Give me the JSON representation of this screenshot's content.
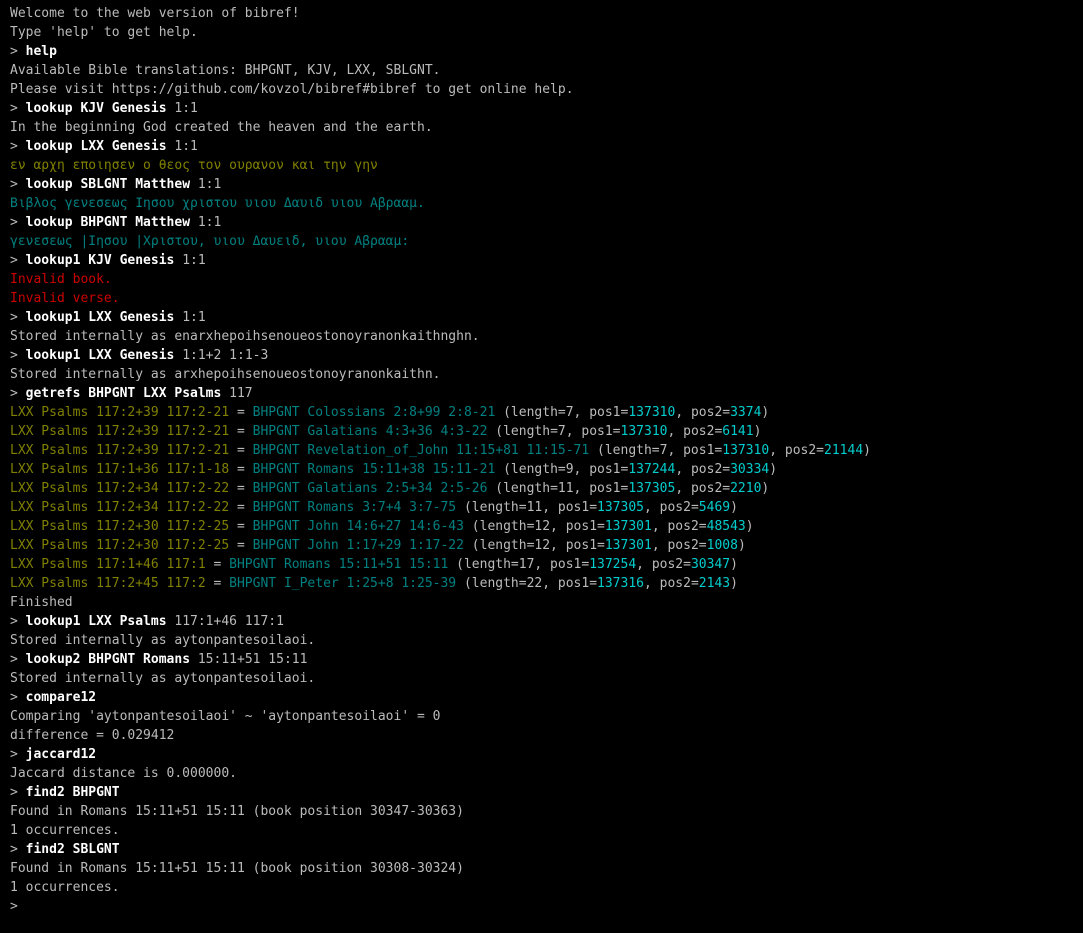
{
  "intro": [
    "Welcome to the web version of bibref!",
    "Type 'help' to get help."
  ],
  "blocks": [
    {
      "cmd_bold": "help",
      "cmd_rest": "",
      "out": [
        "Available Bible translations: BHPGNT, KJV, LXX, SBLGNT.",
        "Please visit https://github.com/kovzol/bibref#bibref to get online help."
      ]
    },
    {
      "cmd_bold": "lookup KJV Genesis",
      "cmd_rest": " 1:1",
      "out": [
        "In the beginning God created the heaven and the earth."
      ]
    },
    {
      "cmd_bold": "lookup LXX Genesis",
      "cmd_rest": " 1:1",
      "out_olive": [
        "εν αρχη εποιησεν ο θεος τον ουρανον και την γην"
      ]
    },
    {
      "cmd_bold": "lookup SBLGNT Matthew",
      "cmd_rest": " 1:1",
      "out_teal": [
        "Βιβλος γενεσεως Ιησου χριστου υιου Δαυιδ υιου Αβρααμ."
      ]
    },
    {
      "cmd_bold": "lookup BHPGNT Matthew",
      "cmd_rest": " 1:1",
      "out_teal": [
        "γενεσεως |Ιησου |Χριστου, υιου Δαυειδ, υιου Αβρααμ:"
      ]
    },
    {
      "cmd_bold": "lookup1 KJV Genesis",
      "cmd_rest": " 1:1",
      "out_red": [
        "Invalid book.",
        "Invalid verse."
      ]
    },
    {
      "cmd_bold": "lookup1 LXX Genesis",
      "cmd_rest": " 1:1",
      "out": [
        "Stored internally as enarxhepoihsenoueostonoyranonkaithnghn."
      ]
    },
    {
      "cmd_bold": "lookup1 LXX Genesis",
      "cmd_rest": " 1:1+2 1:1-3",
      "out": [
        "Stored internally as arxhepoihsenoueostonoyranonkaithn."
      ]
    },
    {
      "cmd_bold": "getrefs BHPGNT LXX Psalms",
      "cmd_rest": " 117",
      "refs": [
        {
          "lxx": "LXX Psalms 117:2+39 117:2-21",
          "eq": " = ",
          "bhp": "BHPGNT Colossians 2:8+99 2:8-21",
          "meta": " (length=7, pos1=",
          "p1": "137310",
          "sep": ", pos2=",
          "p2": "3374",
          "tail": ")"
        },
        {
          "lxx": "LXX Psalms 117:2+39 117:2-21",
          "eq": " = ",
          "bhp": "BHPGNT Galatians 4:3+36 4:3-22",
          "meta": " (length=7, pos1=",
          "p1": "137310",
          "sep": ", pos2=",
          "p2": "6141",
          "tail": ")"
        },
        {
          "lxx": "LXX Psalms 117:2+39 117:2-21",
          "eq": " = ",
          "bhp": "BHPGNT Revelation_of_John 11:15+81 11:15-71",
          "meta": " (length=7, pos1=",
          "p1": "137310",
          "sep": ", pos2=",
          "p2": "21144",
          "tail": ")"
        },
        {
          "lxx": "LXX Psalms 117:1+36 117:1-18",
          "eq": " = ",
          "bhp": "BHPGNT Romans 15:11+38 15:11-21",
          "meta": " (length=9, pos1=",
          "p1": "137244",
          "sep": ", pos2=",
          "p2": "30334",
          "tail": ")"
        },
        {
          "lxx": "LXX Psalms 117:2+34 117:2-22",
          "eq": " = ",
          "bhp": "BHPGNT Galatians 2:5+34 2:5-26",
          "meta": " (length=11, pos1=",
          "p1": "137305",
          "sep": ", pos2=",
          "p2": "2210",
          "tail": ")"
        },
        {
          "lxx": "LXX Psalms 117:2+34 117:2-22",
          "eq": " = ",
          "bhp": "BHPGNT Romans 3:7+4 3:7-75",
          "meta": " (length=11, pos1=",
          "p1": "137305",
          "sep": ", pos2=",
          "p2": "5469",
          "tail": ")"
        },
        {
          "lxx": "LXX Psalms 117:2+30 117:2-25",
          "eq": " = ",
          "bhp": "BHPGNT John 14:6+27 14:6-43",
          "meta": " (length=12, pos1=",
          "p1": "137301",
          "sep": ", pos2=",
          "p2": "48543",
          "tail": ")"
        },
        {
          "lxx": "LXX Psalms 117:2+30 117:2-25",
          "eq": " = ",
          "bhp": "BHPGNT John 1:17+29 1:17-22",
          "meta": " (length=12, pos1=",
          "p1": "137301",
          "sep": ", pos2=",
          "p2": "1008",
          "tail": ")"
        },
        {
          "lxx": "LXX Psalms 117:1+46 117:1",
          "eq": " = ",
          "bhp": "BHPGNT Romans 15:11+51 15:11",
          "meta": " (length=17, pos1=",
          "p1": "137254",
          "sep": ", pos2=",
          "p2": "30347",
          "tail": ")"
        },
        {
          "lxx": "LXX Psalms 117:2+45 117:2",
          "eq": " = ",
          "bhp": "BHPGNT I_Peter 1:25+8 1:25-39",
          "meta": " (length=22, pos1=",
          "p1": "137316",
          "sep": ", pos2=",
          "p2": "2143",
          "tail": ")"
        }
      ],
      "out_after": [
        "Finished"
      ]
    },
    {
      "cmd_bold": "lookup1 LXX Psalms",
      "cmd_rest": " 117:1+46 117:1",
      "out": [
        "Stored internally as aytonpantesoilaoi."
      ]
    },
    {
      "cmd_bold": "lookup2 BHPGNT Romans",
      "cmd_rest": " 15:11+51 15:11",
      "out": [
        "Stored internally as aytonpantesoilaoi."
      ]
    },
    {
      "cmd_bold": "compare12",
      "cmd_rest": "",
      "out": [
        "Comparing 'aytonpantesoilaoi' ~ 'aytonpantesoilaoi' = 0",
        "difference = 0.029412"
      ]
    },
    {
      "cmd_bold": "jaccard12",
      "cmd_rest": "",
      "out": [
        "Jaccard distance is 0.000000."
      ]
    },
    {
      "cmd_bold": "find2 BHPGNT",
      "cmd_rest": "",
      "out": [
        "Found in Romans 15:11+51 15:11 (book position 30347-30363)",
        "1 occurrences."
      ]
    },
    {
      "cmd_bold": "find2 SBLGNT",
      "cmd_rest": "",
      "out": [
        "Found in Romans 15:11+51 15:11 (book position 30308-30324)",
        "1 occurrences."
      ]
    }
  ],
  "final_prompt": "> "
}
